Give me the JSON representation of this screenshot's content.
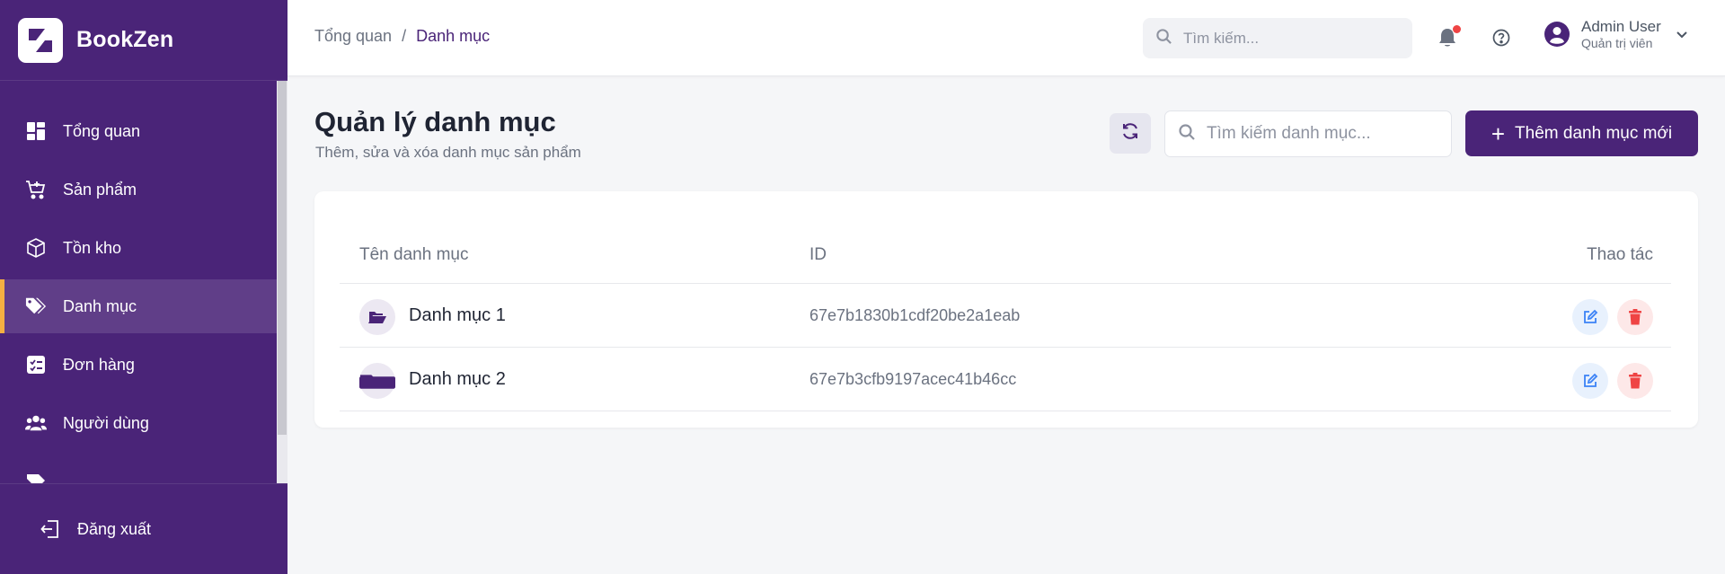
{
  "brand": {
    "name": "BookZen"
  },
  "sidebar": {
    "items": [
      {
        "label": "Tổng quan",
        "icon": "dashboard-icon",
        "active": false
      },
      {
        "label": "Sản phẩm",
        "icon": "cart-icon",
        "active": false
      },
      {
        "label": "Tồn kho",
        "icon": "box-icon",
        "active": false
      },
      {
        "label": "Danh mục",
        "icon": "tags-icon",
        "active": true
      },
      {
        "label": "Đơn hàng",
        "icon": "order-list-icon",
        "active": false
      },
      {
        "label": "Người dùng",
        "icon": "users-icon",
        "active": false
      }
    ],
    "logout_label": "Đăng xuất"
  },
  "topbar": {
    "breadcrumb": {
      "root": "Tổng quan",
      "separator": "/",
      "current": "Danh mục"
    },
    "search_placeholder": "Tìm kiếm...",
    "user": {
      "name": "Admin User",
      "role": "Quản trị viên"
    }
  },
  "main": {
    "title": "Quản lý danh mục",
    "subtitle": "Thêm, sửa và xóa danh mục sản phẩm",
    "search_placeholder": "Tìm kiếm danh mục...",
    "add_button_label": "Thêm danh mục mới",
    "table": {
      "columns": [
        "Tên danh mục",
        "ID",
        "Thao tác"
      ],
      "rows": [
        {
          "name": "Danh mục 1",
          "id": "67e7b1830b1cdf20be2a1eab"
        },
        {
          "name": "Danh mục 2",
          "id": "67e7b3cfb9197acec41b46cc"
        }
      ]
    }
  },
  "colors": {
    "primary": "#4a2478",
    "active_indicator": "#f5b042",
    "notification_dot": "#ef4444",
    "edit": "#3b82f6",
    "delete": "#ef4444"
  }
}
